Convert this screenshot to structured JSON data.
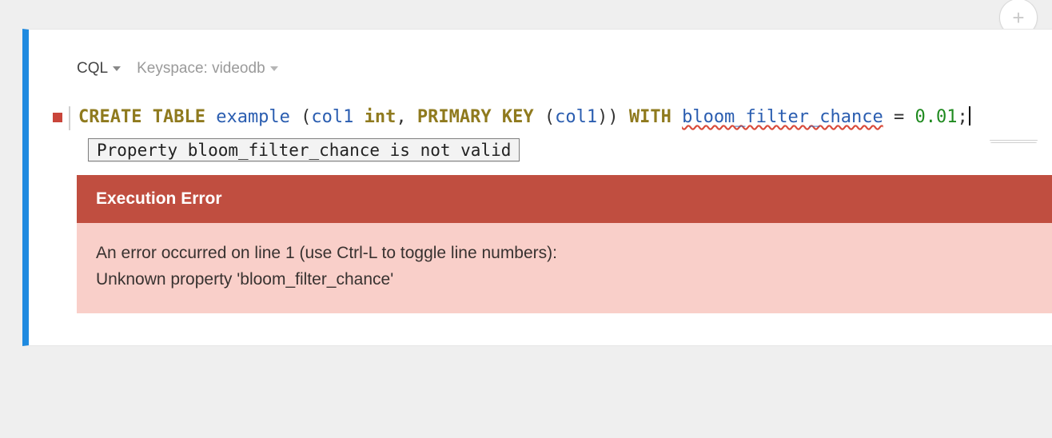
{
  "add_button_glyph": "+",
  "header": {
    "language": "CQL",
    "keyspace_label": "Keyspace: videodb"
  },
  "code": {
    "kw_create_table": "CREATE TABLE",
    "table_name": "example",
    "lparen1": " (",
    "col_name": "col1 ",
    "col_type": "int",
    "comma": ", ",
    "kw_primary_key": "PRIMARY KEY",
    "pk_paren": " (",
    "pk_col": "col1",
    "pk_close": "))",
    "kw_with": " WITH ",
    "prop_name": "bloom_filter_chance",
    "eq": " = ",
    "value": "0.01",
    "semicolon": ";"
  },
  "tooltip": "Property bloom_filter_chance is not valid",
  "error": {
    "title": "Execution Error",
    "line1": "An error occurred on line 1 (use Ctrl-L to toggle line numbers):",
    "line2": "Unknown property 'bloom_filter_chance'"
  }
}
